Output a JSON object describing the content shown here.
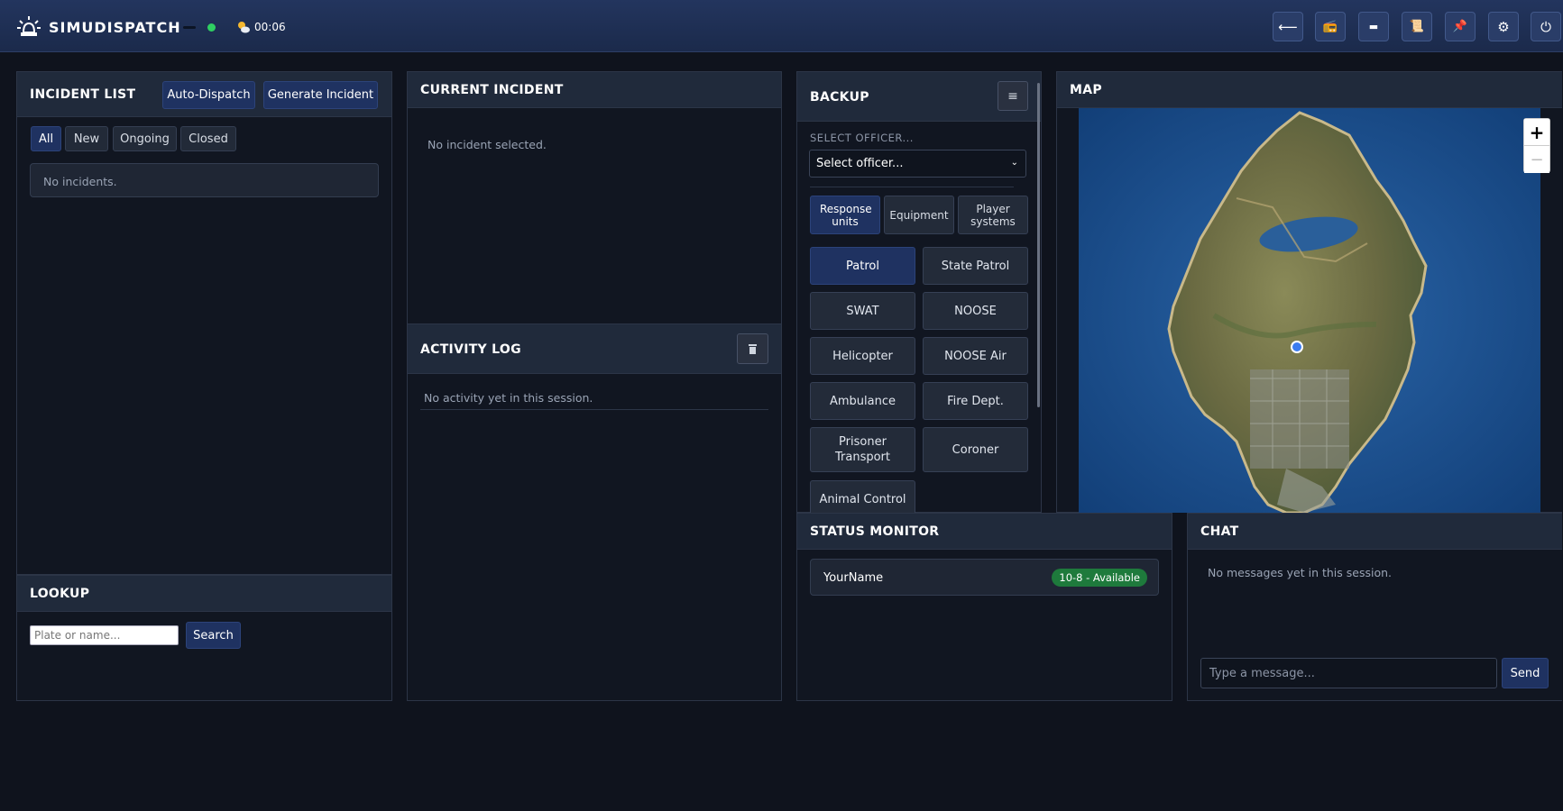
{
  "app": {
    "name": "SIMUDISPATCH",
    "clock": "00:06"
  },
  "toolbar": {
    "buttons": [
      {
        "icon": "back-arrow-icon",
        "glyph": "⟵"
      },
      {
        "icon": "radio-icon",
        "glyph": "📻"
      },
      {
        "icon": "bodycam-icon",
        "glyph": "▬"
      },
      {
        "icon": "notes-icon",
        "glyph": "📜"
      },
      {
        "icon": "pin-icon",
        "glyph": "📌"
      },
      {
        "icon": "gear-icon",
        "glyph": "⚙"
      },
      {
        "icon": "power-icon",
        "glyph": "⏻"
      }
    ]
  },
  "incident_list": {
    "title": "INCIDENT LIST",
    "auto_dispatch": "Auto-Dispatch",
    "generate": "Generate Incident",
    "filters": [
      "All",
      "New",
      "Ongoing",
      "Closed"
    ],
    "active_filter": "All",
    "empty": "No incidents."
  },
  "lookup": {
    "title": "LOOKUP",
    "placeholder": "Plate or name...",
    "search": "Search"
  },
  "current_incident": {
    "title": "CURRENT INCIDENT",
    "empty": "No incident selected."
  },
  "activity_log": {
    "title": "ACTIVITY LOG",
    "empty": "No activity yet in this session."
  },
  "backup": {
    "title": "BACKUP",
    "officer_label": "SELECT OFFICER...",
    "officer_select": "Select officer...",
    "tabs": [
      "Response units",
      "Equipment",
      "Player systems"
    ],
    "active_tab": "Response units",
    "units": [
      "Patrol",
      "State Patrol",
      "SWAT",
      "NOOSE",
      "Helicopter",
      "NOOSE Air",
      "Ambulance",
      "Fire Dept.",
      "Prisoner Transport",
      "Coroner",
      "Animal Control"
    ],
    "active_unit": "Patrol"
  },
  "map": {
    "title": "MAP",
    "zoom_in": "+",
    "zoom_out": "−"
  },
  "status_monitor": {
    "title": "STATUS MONITOR",
    "officer": "YourName",
    "status": "10-8 - Available",
    "status_color": "#1e7a3c"
  },
  "chat": {
    "title": "CHAT",
    "empty": "No messages yet in this session.",
    "placeholder": "Type a message...",
    "send": "Send"
  }
}
